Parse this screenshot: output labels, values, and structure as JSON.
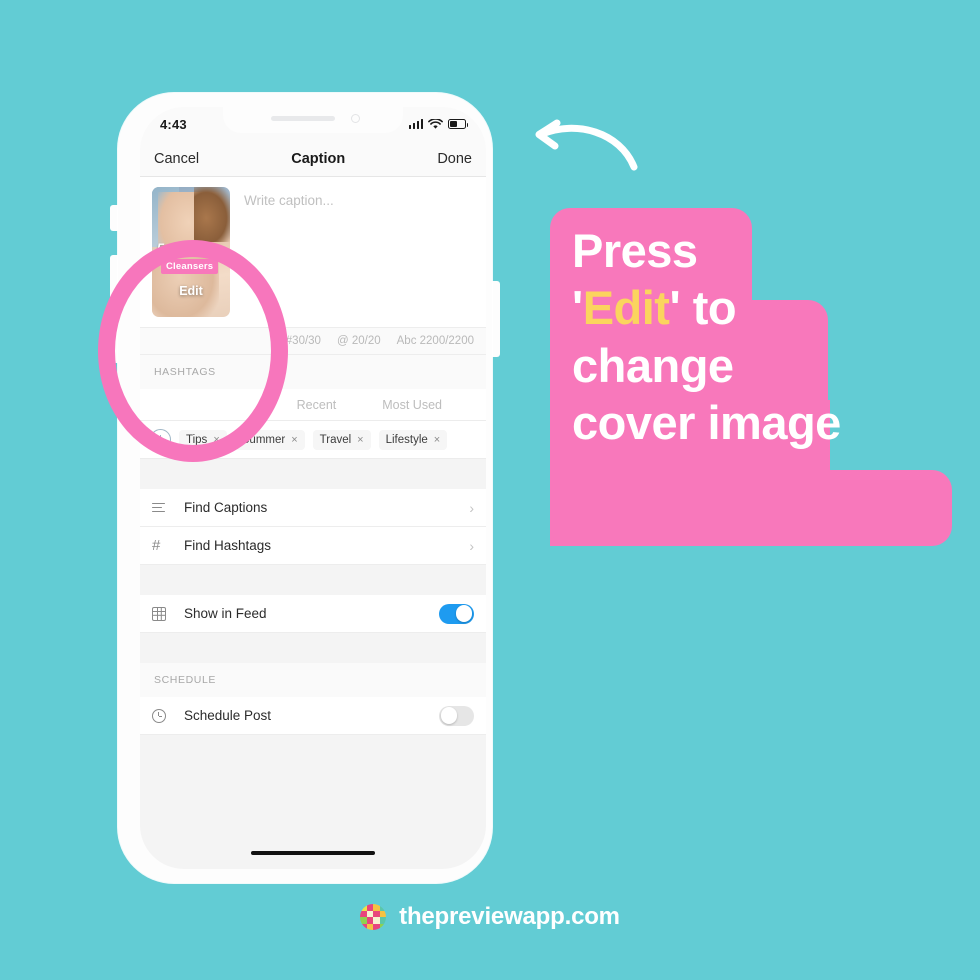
{
  "background_color": "#62CCD4",
  "accent_pink": "#F878BB",
  "accent_yellow": "#FBD45E",
  "phone": {
    "status_bar": {
      "time": "4:43",
      "signal_icon": "cellular-bars-icon",
      "wifi_icon": "wifi-icon",
      "battery_icon": "battery-icon"
    },
    "nav_bar": {
      "cancel_label": "Cancel",
      "title": "Caption",
      "done_label": "Done"
    },
    "caption": {
      "placeholder": "Write caption...",
      "thumbnail": {
        "overlay_title": "Favorite",
        "overlay_subtitle": "Cleansers",
        "edit_label": "Edit"
      }
    },
    "counters": {
      "hashtags": "#30/30",
      "mentions": "@ 20/20",
      "characters": "Abc 2200/2200"
    },
    "hashtags_section": {
      "label": "HASHTAGS",
      "tabs": [
        "Recent",
        "Most Used"
      ],
      "add_button": "add-hashtag-icon",
      "pills": [
        {
          "label": "Tips",
          "remove": "×"
        },
        {
          "label": "Summer",
          "remove": "×"
        },
        {
          "label": "Travel",
          "remove": "×"
        },
        {
          "label": "Lifestyle",
          "remove": "×"
        }
      ]
    },
    "menu_rows": [
      {
        "icon": "lines-icon",
        "label": "Find Captions",
        "chevron": "›"
      },
      {
        "icon": "hash-icon",
        "label": "Find Hashtags",
        "chevron": "›"
      }
    ],
    "feed_row": {
      "icon": "grid-icon",
      "label": "Show in Feed",
      "toggle_state": "on"
    },
    "schedule_section": {
      "label": "SCHEDULE",
      "row": {
        "icon": "clock-icon",
        "label": "Schedule Post",
        "toggle_state": "off"
      }
    }
  },
  "callout": {
    "line1": "Press",
    "line2_pre": "'",
    "line2_hl": "Edit",
    "line2_post": "' to",
    "line3": "change",
    "line4": "cover image"
  },
  "footer": {
    "brand": "thepreviewapp.com",
    "logo": "preview-app-logo-icon"
  }
}
